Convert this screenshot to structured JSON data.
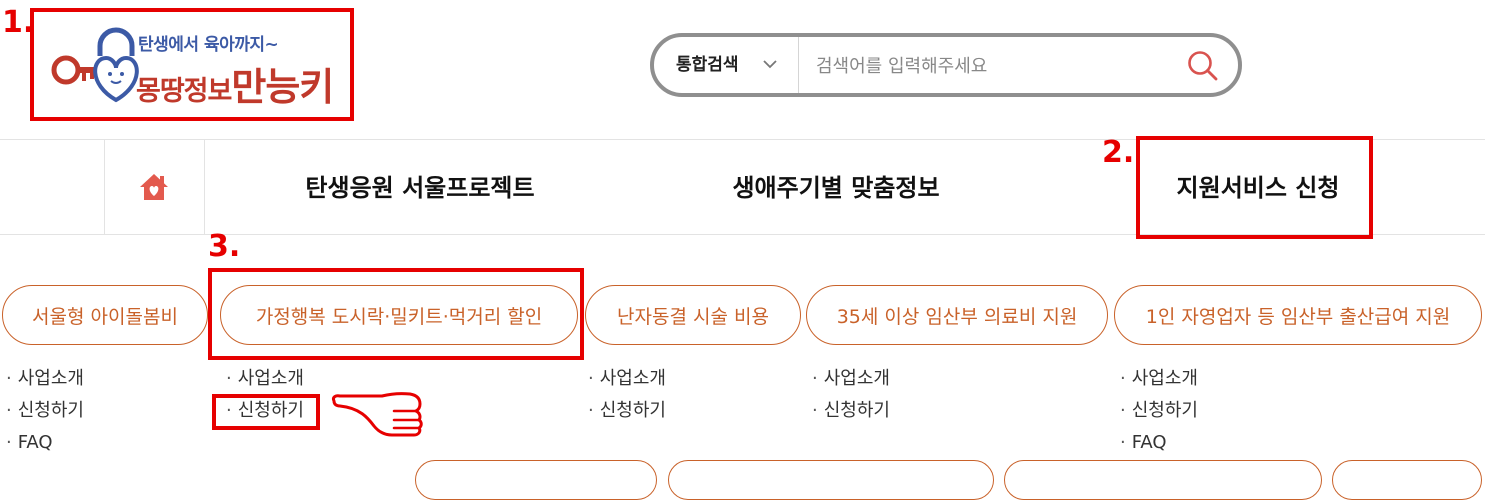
{
  "annotations": {
    "n1": "1.",
    "n2": "2.",
    "n3": "3."
  },
  "logo": {
    "tagline": "탄생에서 육아까지~",
    "title_part1": "몽땅정보",
    "title_part2": "만능키"
  },
  "search": {
    "category": "통합검색",
    "placeholder": "검색어를 입력해주세요"
  },
  "nav": {
    "items": [
      "탄생응원 서울프로젝트",
      "생애주기별 맞춤정보",
      "지원서비스 신청"
    ]
  },
  "services": [
    {
      "title": "서울형 아이돌봄비",
      "links": [
        "사업소개",
        "신청하기",
        "FAQ"
      ]
    },
    {
      "title": "가정행복 도시락·밀키트·먹거리 할인",
      "links": [
        "사업소개",
        "신청하기"
      ]
    },
    {
      "title": "난자동결 시술 비용",
      "links": [
        "사업소개",
        "신청하기"
      ]
    },
    {
      "title": "35세 이상 임산부 의료비 지원",
      "links": [
        "사업소개",
        "신청하기"
      ]
    },
    {
      "title": "1인 자영업자 등 임산부 출산급여 지원",
      "links": [
        "사업소개",
        "신청하기",
        "FAQ"
      ]
    }
  ],
  "colors": {
    "accent": "#c9622a",
    "annotation": "#e60000",
    "home_icon": "#e35a4e"
  }
}
